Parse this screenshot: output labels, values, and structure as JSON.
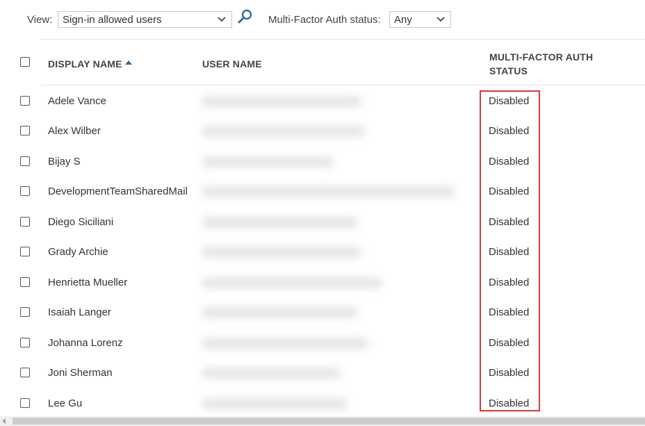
{
  "filters": {
    "view_label": "View:",
    "view_selected": "Sign-in allowed users",
    "mfa_label": "Multi-Factor Auth status:",
    "mfa_selected": "Any"
  },
  "table": {
    "columns": {
      "display_name": "DISPLAY NAME",
      "user_name": "USER NAME",
      "mfa_status_line1": "MULTI-FACTOR AUTH",
      "mfa_status_line2": "STATUS"
    },
    "sort": {
      "column": "display_name",
      "direction": "ascending"
    },
    "rows": [
      {
        "display_name": "Adele Vance",
        "mfa_status": "Disabled"
      },
      {
        "display_name": "Alex Wilber",
        "mfa_status": "Disabled"
      },
      {
        "display_name": "Bijay S",
        "mfa_status": "Disabled"
      },
      {
        "display_name": "DevelopmentTeamSharedMail",
        "mfa_status": "Disabled"
      },
      {
        "display_name": "Diego Siciliani",
        "mfa_status": "Disabled"
      },
      {
        "display_name": "Grady Archie",
        "mfa_status": "Disabled"
      },
      {
        "display_name": "Henrietta Mueller",
        "mfa_status": "Disabled"
      },
      {
        "display_name": "Isaiah Langer",
        "mfa_status": "Disabled"
      },
      {
        "display_name": "Johanna Lorenz",
        "mfa_status": "Disabled"
      },
      {
        "display_name": "Joni Sherman",
        "mfa_status": "Disabled"
      },
      {
        "display_name": "Lee Gu",
        "mfa_status": "Disabled"
      }
    ]
  },
  "icons": {
    "search": "search-icon",
    "sort": "sort-ascending-icon",
    "dropdown": "chevron-down-icon"
  },
  "colors": {
    "highlight_border": "#d9383b",
    "text": "#333333",
    "rule": "#e1e1e1"
  }
}
